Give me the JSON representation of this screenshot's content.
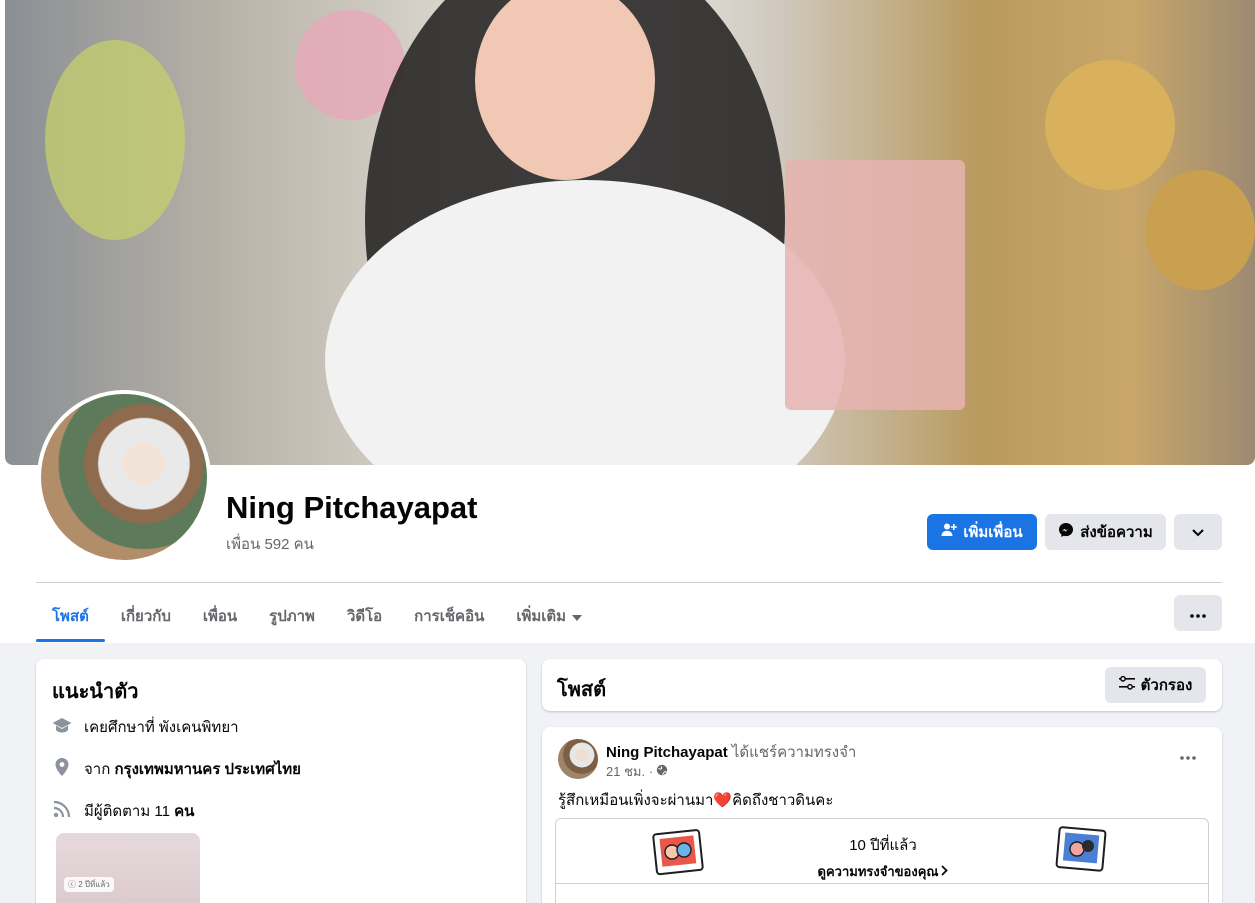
{
  "profile": {
    "name": "Ning Pitchayapat",
    "friends": "เพื่อน 592 คน"
  },
  "actions": {
    "add_friend": "เพิ่มเพื่อน",
    "message": "ส่งข้อความ"
  },
  "tabs": [
    {
      "label": "โพสต์",
      "active": true
    },
    {
      "label": "เกี่ยวกับ"
    },
    {
      "label": "เพื่อน"
    },
    {
      "label": "รูปภาพ"
    },
    {
      "label": "วิดีโอ"
    },
    {
      "label": "การเช็คอิน"
    },
    {
      "label": "เพิ่มเติม"
    }
  ],
  "intro": {
    "title": "แนะนำตัว",
    "studied": "เคยศึกษาที่ พังเคนพิทยา",
    "from_prefix": "จาก",
    "from_place": "กรุงเทพมหานคร ประเทศไทย",
    "followers_prefix": "มีผู้ติดตาม 11",
    "followers_suffix": "คน",
    "photo_badge": "ⓒ 2 ปีที่แล้ว"
  },
  "posts": {
    "title": "โพสต์",
    "filter_label": "ตัวกรอง"
  },
  "post": {
    "author": "Ning Pitchayapat",
    "action": "ได้แชร์ความทรงจำ",
    "time": "21 ชม. ·",
    "text": "รู้สึกเหมือนเพิ่งจะผ่านมา❤️คิดถึงชาวดินคะ",
    "memory_years": "10 ปีที่แล้ว",
    "memory_link": "ดูความทรงจำของคุณ"
  },
  "colors": {
    "accent": "#1b74e4",
    "page_bg": "#f0f2f5",
    "muted_text": "#65676b"
  }
}
